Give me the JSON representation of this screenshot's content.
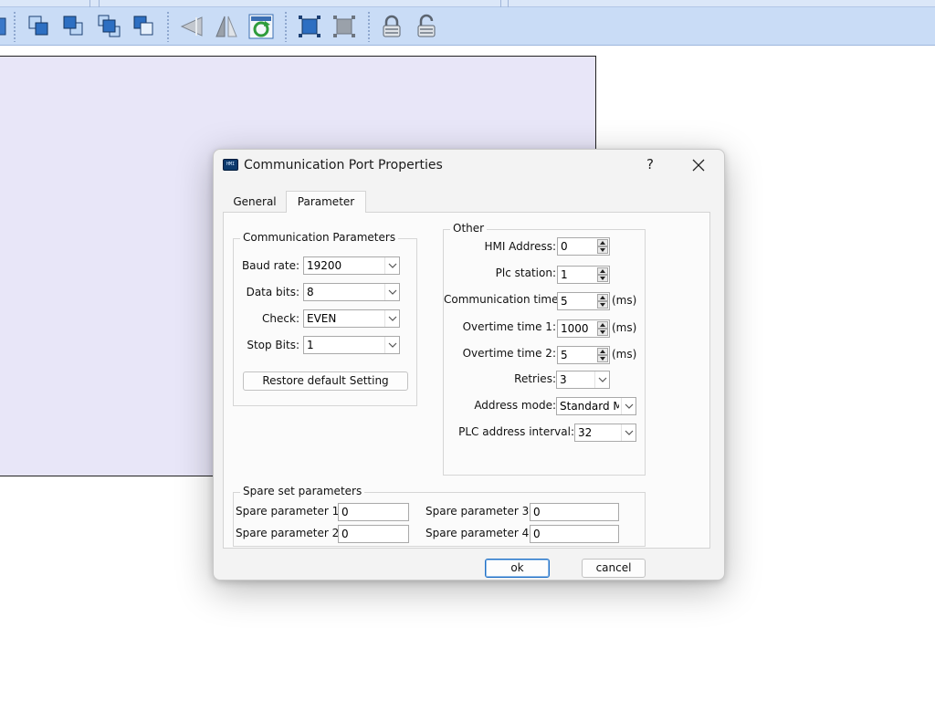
{
  "toolbar": {
    "buttons": [
      "bring-forward-icon",
      "send-backward-icon",
      "bring-to-front-icon",
      "send-to-back-icon",
      "flip-horizontal-icon",
      "flip-vertical-icon",
      "refresh-icon",
      "group-icon",
      "ungroup-icon",
      "lock-icon",
      "unlock-icon"
    ]
  },
  "dialog": {
    "title": "Communication Port Properties",
    "help_label": "?",
    "icon_text": "HMI",
    "tabs": [
      {
        "label": "General",
        "active": false
      },
      {
        "label": "Parameter",
        "active": true
      }
    ],
    "comm_params": {
      "title": "Communication Parameters",
      "baud_rate": {
        "label": "Baud rate:",
        "value": "19200"
      },
      "data_bits": {
        "label": "Data bits:",
        "value": "8"
      },
      "check": {
        "label": "Check:",
        "value": "EVEN"
      },
      "stop_bits": {
        "label": "Stop Bits:",
        "value": "1"
      },
      "restore_label": "Restore default Setting"
    },
    "other": {
      "title": "Other",
      "hmi_address": {
        "label": "HMI Address:",
        "value": "0"
      },
      "plc_station": {
        "label": "Plc station:",
        "value": "1"
      },
      "comm_time": {
        "label": "Communication time:",
        "value": "5",
        "unit": "(ms)"
      },
      "overtime1": {
        "label": "Overtime time 1:",
        "value": "1000",
        "unit": "(ms)"
      },
      "overtime2": {
        "label": "Overtime time 2:",
        "value": "5",
        "unit": "(ms)"
      },
      "retries": {
        "label": "Retries:",
        "value": "3"
      },
      "address_mode": {
        "label": "Address mode:",
        "value": "Standard Mode"
      },
      "plc_interval": {
        "label": "PLC address interval:",
        "value": "32"
      }
    },
    "spare": {
      "title": "Spare set parameters",
      "p1": {
        "label": "Spare parameter 1:",
        "value": "0"
      },
      "p2": {
        "label": "Spare parameter 2:",
        "value": "0"
      },
      "p3": {
        "label": "Spare parameter 3:",
        "value": "0"
      },
      "p4": {
        "label": "Spare parameter 4:",
        "value": "0"
      }
    },
    "ok_label": "ok",
    "cancel_label": "cancel"
  }
}
